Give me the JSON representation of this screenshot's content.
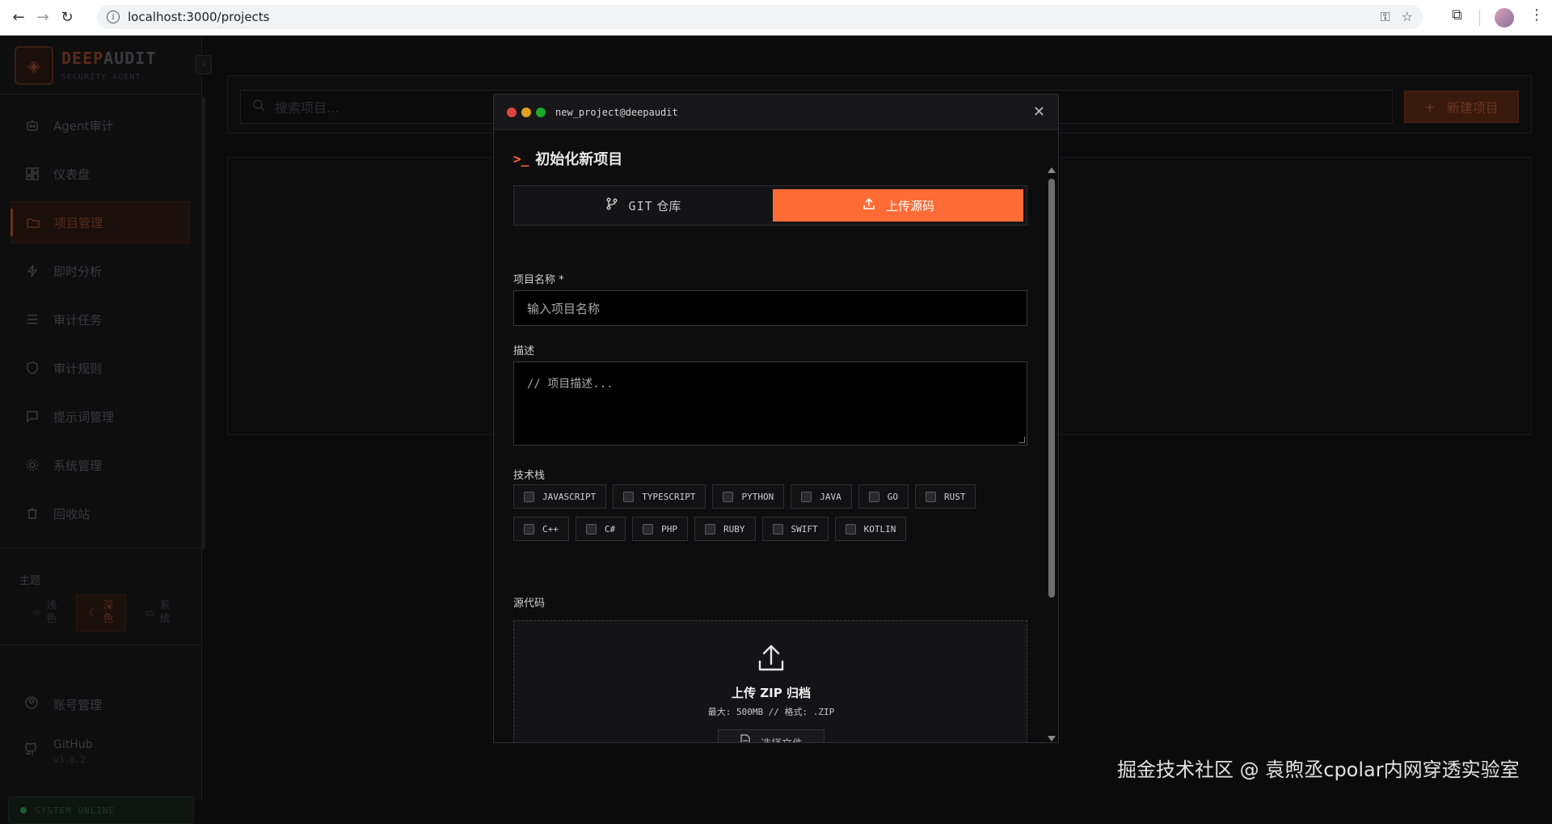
{
  "browser": {
    "url": "localhost:3000/projects"
  },
  "sidebar": {
    "brand_main": "DEEP",
    "brand_accent": "AUDIT",
    "brand_sub": "SECURITY AGENT",
    "items": [
      {
        "label": "Agent审计",
        "icon": "bot-icon"
      },
      {
        "label": "仪表盘",
        "icon": "dashboard-icon"
      },
      {
        "label": "项目管理",
        "icon": "folder-icon",
        "active": true
      },
      {
        "label": "即时分析",
        "icon": "lightning-icon"
      },
      {
        "label": "审计任务",
        "icon": "list-icon"
      },
      {
        "label": "审计规则",
        "icon": "shield-icon"
      },
      {
        "label": "提示词管理",
        "icon": "message-icon"
      },
      {
        "label": "系统管理",
        "icon": "gear-icon"
      },
      {
        "label": "回收站",
        "icon": "trash-icon"
      }
    ],
    "theme_label": "主题",
    "theme_options": [
      {
        "l1": "浅",
        "l2": "色"
      },
      {
        "l1": "深",
        "l2": "色",
        "active": true
      },
      {
        "l1": "系",
        "l2": "统"
      }
    ],
    "account": "账号管理",
    "github": "GitHub",
    "version": "v3.0.2",
    "status": "SYSTEM ONLINE"
  },
  "main": {
    "search_placeholder": "搜索项目...",
    "new_project": "新建项目"
  },
  "modal": {
    "window_title": "new_project@deepaudit",
    "heading": "初始化新项目",
    "tabs": [
      {
        "label_mono": "GIT",
        "label": "仓库",
        "icon": "git-branch-icon"
      },
      {
        "label": "上传源码",
        "icon": "upload-icon",
        "active": true
      }
    ],
    "name_label": "项目名称 *",
    "name_placeholder": "输入项目名称",
    "desc_label": "描述",
    "desc_placeholder": "// 项目描述...",
    "stack_label": "技术栈",
    "stack_row1": [
      "JAVASCRIPT",
      "TYPESCRIPT",
      "PYTHON",
      "JAVA",
      "GO",
      "RUST"
    ],
    "stack_row2": [
      "C++",
      "C#",
      "PHP",
      "RUBY",
      "SWIFT",
      "KOTLIN"
    ],
    "source_label": "源代码",
    "upload_title": "上传 ZIP 归档",
    "upload_sub": "最大: 500MB // 格式: .ZIP",
    "choose_file": "选择文件"
  },
  "watermark": "掘金技术社区 @ 袁煦丞cpolar内网穿透实验室",
  "colors": {
    "accent": "#ff6b35",
    "dot_red": "#e0443e",
    "dot_yellow": "#dea123",
    "dot_green": "#1aab29"
  }
}
